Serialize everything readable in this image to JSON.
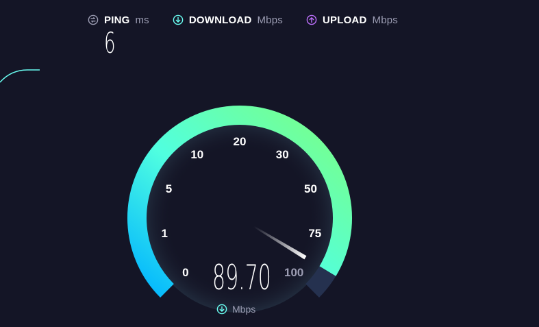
{
  "metrics": {
    "ping": {
      "label": "PING",
      "unit": "ms",
      "value": "6",
      "icon": "ping-icon"
    },
    "download": {
      "label": "DOWNLOAD",
      "unit": "Mbps",
      "icon": "download-arrow-icon",
      "color": "#6afff3"
    },
    "upload": {
      "label": "UPLOAD",
      "unit": "Mbps",
      "icon": "upload-arrow-icon",
      "color": "#bf71ff"
    }
  },
  "gauge": {
    "value": 89.7,
    "value_text": "89.70",
    "unit": "Mbps",
    "max": 100,
    "ticks": [
      "0",
      "1",
      "5",
      "10",
      "20",
      "30",
      "50",
      "75",
      "100"
    ],
    "colors": {
      "start": "#00b4ff",
      "mid": "#50ffe0",
      "end": "#7cff83",
      "track": "#25314f"
    }
  }
}
